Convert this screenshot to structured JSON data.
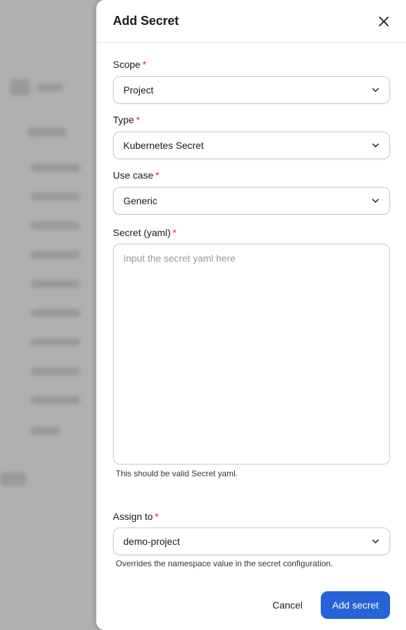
{
  "drawer": {
    "title": "Add Secret",
    "close_icon": "close-icon"
  },
  "fields": {
    "scope": {
      "label": "Scope",
      "required_mark": "*",
      "value": "Project"
    },
    "type": {
      "label": "Type",
      "required_mark": "*",
      "value": "Kubernetes Secret"
    },
    "use_case": {
      "label": "Use case",
      "required_mark": "*",
      "value": "Generic"
    },
    "secret_yaml": {
      "label": "Secret (yaml)",
      "required_mark": "*",
      "value": "",
      "placeholder": "Input the secret yaml here",
      "helper": "This should be valid Secret yaml."
    },
    "assign_to": {
      "label": "Assign to",
      "required_mark": "*",
      "value": "demo-project",
      "helper": "Overrides the namespace value in the secret configuration."
    }
  },
  "footer": {
    "cancel_label": "Cancel",
    "submit_label": "Add secret"
  },
  "colors": {
    "primary": "#2563d6",
    "required": "#e0241b"
  }
}
